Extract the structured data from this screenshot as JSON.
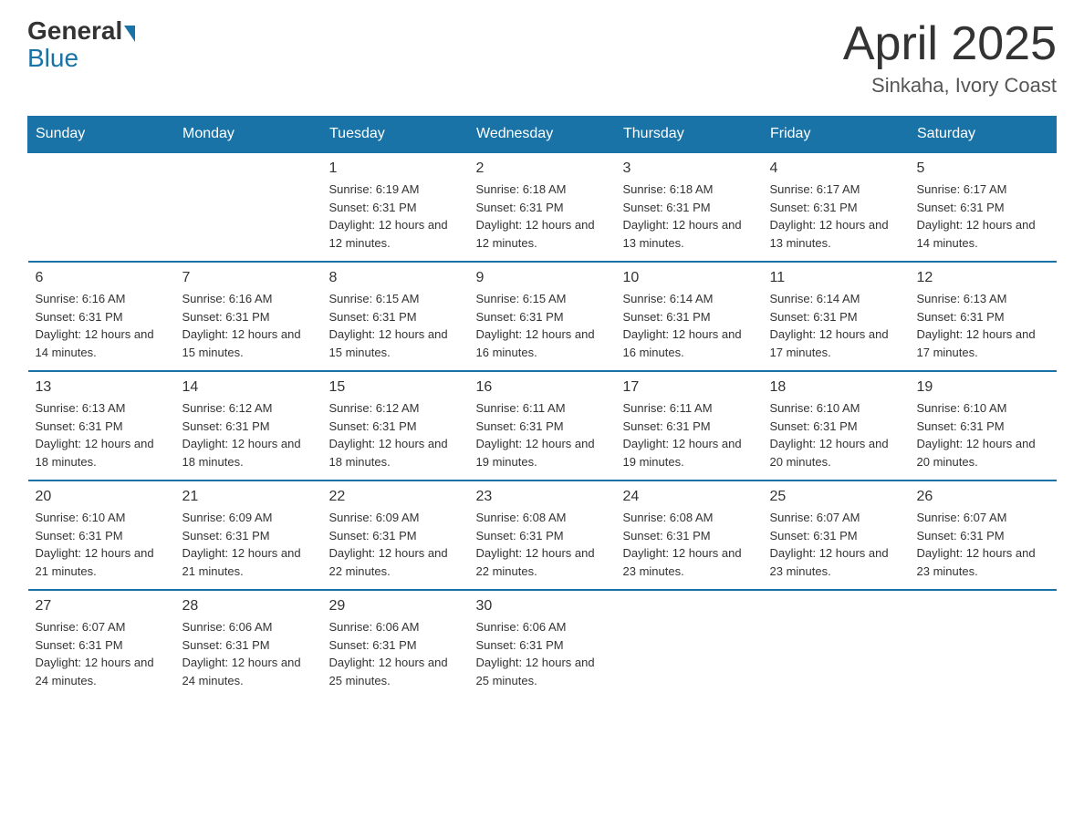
{
  "logo": {
    "general": "General",
    "blue": "Blue"
  },
  "header": {
    "month": "April 2025",
    "location": "Sinkaha, Ivory Coast"
  },
  "weekdays": [
    "Sunday",
    "Monday",
    "Tuesday",
    "Wednesday",
    "Thursday",
    "Friday",
    "Saturday"
  ],
  "weeks": [
    [
      {
        "day": "",
        "sunrise": "",
        "sunset": "",
        "daylight": ""
      },
      {
        "day": "",
        "sunrise": "",
        "sunset": "",
        "daylight": ""
      },
      {
        "day": "1",
        "sunrise": "Sunrise: 6:19 AM",
        "sunset": "Sunset: 6:31 PM",
        "daylight": "Daylight: 12 hours and 12 minutes."
      },
      {
        "day": "2",
        "sunrise": "Sunrise: 6:18 AM",
        "sunset": "Sunset: 6:31 PM",
        "daylight": "Daylight: 12 hours and 12 minutes."
      },
      {
        "day": "3",
        "sunrise": "Sunrise: 6:18 AM",
        "sunset": "Sunset: 6:31 PM",
        "daylight": "Daylight: 12 hours and 13 minutes."
      },
      {
        "day": "4",
        "sunrise": "Sunrise: 6:17 AM",
        "sunset": "Sunset: 6:31 PM",
        "daylight": "Daylight: 12 hours and 13 minutes."
      },
      {
        "day": "5",
        "sunrise": "Sunrise: 6:17 AM",
        "sunset": "Sunset: 6:31 PM",
        "daylight": "Daylight: 12 hours and 14 minutes."
      }
    ],
    [
      {
        "day": "6",
        "sunrise": "Sunrise: 6:16 AM",
        "sunset": "Sunset: 6:31 PM",
        "daylight": "Daylight: 12 hours and 14 minutes."
      },
      {
        "day": "7",
        "sunrise": "Sunrise: 6:16 AM",
        "sunset": "Sunset: 6:31 PM",
        "daylight": "Daylight: 12 hours and 15 minutes."
      },
      {
        "day": "8",
        "sunrise": "Sunrise: 6:15 AM",
        "sunset": "Sunset: 6:31 PM",
        "daylight": "Daylight: 12 hours and 15 minutes."
      },
      {
        "day": "9",
        "sunrise": "Sunrise: 6:15 AM",
        "sunset": "Sunset: 6:31 PM",
        "daylight": "Daylight: 12 hours and 16 minutes."
      },
      {
        "day": "10",
        "sunrise": "Sunrise: 6:14 AM",
        "sunset": "Sunset: 6:31 PM",
        "daylight": "Daylight: 12 hours and 16 minutes."
      },
      {
        "day": "11",
        "sunrise": "Sunrise: 6:14 AM",
        "sunset": "Sunset: 6:31 PM",
        "daylight": "Daylight: 12 hours and 17 minutes."
      },
      {
        "day": "12",
        "sunrise": "Sunrise: 6:13 AM",
        "sunset": "Sunset: 6:31 PM",
        "daylight": "Daylight: 12 hours and 17 minutes."
      }
    ],
    [
      {
        "day": "13",
        "sunrise": "Sunrise: 6:13 AM",
        "sunset": "Sunset: 6:31 PM",
        "daylight": "Daylight: 12 hours and 18 minutes."
      },
      {
        "day": "14",
        "sunrise": "Sunrise: 6:12 AM",
        "sunset": "Sunset: 6:31 PM",
        "daylight": "Daylight: 12 hours and 18 minutes."
      },
      {
        "day": "15",
        "sunrise": "Sunrise: 6:12 AM",
        "sunset": "Sunset: 6:31 PM",
        "daylight": "Daylight: 12 hours and 18 minutes."
      },
      {
        "day": "16",
        "sunrise": "Sunrise: 6:11 AM",
        "sunset": "Sunset: 6:31 PM",
        "daylight": "Daylight: 12 hours and 19 minutes."
      },
      {
        "day": "17",
        "sunrise": "Sunrise: 6:11 AM",
        "sunset": "Sunset: 6:31 PM",
        "daylight": "Daylight: 12 hours and 19 minutes."
      },
      {
        "day": "18",
        "sunrise": "Sunrise: 6:10 AM",
        "sunset": "Sunset: 6:31 PM",
        "daylight": "Daylight: 12 hours and 20 minutes."
      },
      {
        "day": "19",
        "sunrise": "Sunrise: 6:10 AM",
        "sunset": "Sunset: 6:31 PM",
        "daylight": "Daylight: 12 hours and 20 minutes."
      }
    ],
    [
      {
        "day": "20",
        "sunrise": "Sunrise: 6:10 AM",
        "sunset": "Sunset: 6:31 PM",
        "daylight": "Daylight: 12 hours and 21 minutes."
      },
      {
        "day": "21",
        "sunrise": "Sunrise: 6:09 AM",
        "sunset": "Sunset: 6:31 PM",
        "daylight": "Daylight: 12 hours and 21 minutes."
      },
      {
        "day": "22",
        "sunrise": "Sunrise: 6:09 AM",
        "sunset": "Sunset: 6:31 PM",
        "daylight": "Daylight: 12 hours and 22 minutes."
      },
      {
        "day": "23",
        "sunrise": "Sunrise: 6:08 AM",
        "sunset": "Sunset: 6:31 PM",
        "daylight": "Daylight: 12 hours and 22 minutes."
      },
      {
        "day": "24",
        "sunrise": "Sunrise: 6:08 AM",
        "sunset": "Sunset: 6:31 PM",
        "daylight": "Daylight: 12 hours and 23 minutes."
      },
      {
        "day": "25",
        "sunrise": "Sunrise: 6:07 AM",
        "sunset": "Sunset: 6:31 PM",
        "daylight": "Daylight: 12 hours and 23 minutes."
      },
      {
        "day": "26",
        "sunrise": "Sunrise: 6:07 AM",
        "sunset": "Sunset: 6:31 PM",
        "daylight": "Daylight: 12 hours and 23 minutes."
      }
    ],
    [
      {
        "day": "27",
        "sunrise": "Sunrise: 6:07 AM",
        "sunset": "Sunset: 6:31 PM",
        "daylight": "Daylight: 12 hours and 24 minutes."
      },
      {
        "day": "28",
        "sunrise": "Sunrise: 6:06 AM",
        "sunset": "Sunset: 6:31 PM",
        "daylight": "Daylight: 12 hours and 24 minutes."
      },
      {
        "day": "29",
        "sunrise": "Sunrise: 6:06 AM",
        "sunset": "Sunset: 6:31 PM",
        "daylight": "Daylight: 12 hours and 25 minutes."
      },
      {
        "day": "30",
        "sunrise": "Sunrise: 6:06 AM",
        "sunset": "Sunset: 6:31 PM",
        "daylight": "Daylight: 12 hours and 25 minutes."
      },
      {
        "day": "",
        "sunrise": "",
        "sunset": "",
        "daylight": ""
      },
      {
        "day": "",
        "sunrise": "",
        "sunset": "",
        "daylight": ""
      },
      {
        "day": "",
        "sunrise": "",
        "sunset": "",
        "daylight": ""
      }
    ]
  ]
}
